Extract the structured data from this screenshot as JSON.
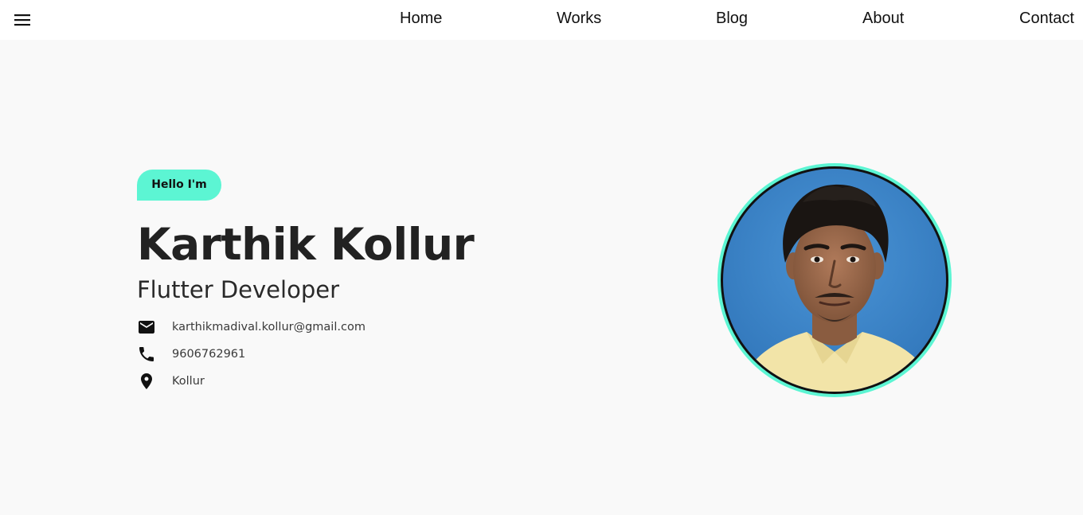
{
  "nav": {
    "menu_icon": "menu-icon",
    "links": [
      "Home",
      "Works",
      "Blog",
      "About",
      "Contact"
    ]
  },
  "hero": {
    "badge": "Hello I'm",
    "name": "Karthik Kollur",
    "role": "Flutter Developer",
    "contacts": [
      {
        "icon": "email-icon",
        "text": "karthikmadival.kollur@gmail.com"
      },
      {
        "icon": "phone-icon",
        "text": "9606762961"
      },
      {
        "icon": "location-pin-icon",
        "text": "Kollur"
      }
    ]
  },
  "colors": {
    "accent": "#5cf5d3",
    "background": "#f9f9f9",
    "navbar": "#ffffff",
    "text": "#222222",
    "photo_background": "#3d86c9"
  }
}
